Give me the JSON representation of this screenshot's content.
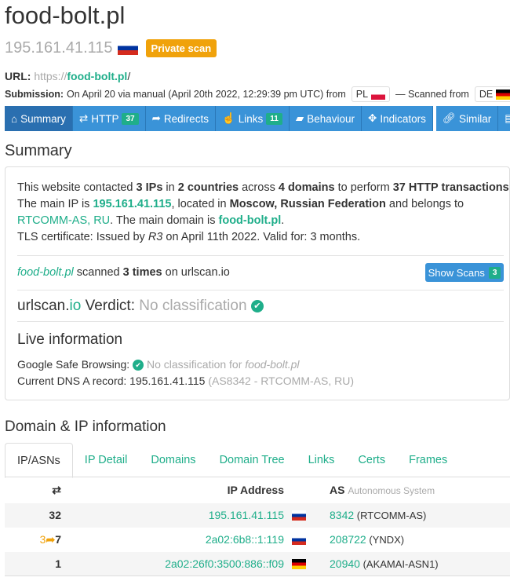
{
  "title": "food-bolt.pl",
  "ip": "195.161.41.115",
  "private_badge": "Private scan",
  "url": {
    "label": "URL:",
    "prefix": "https://",
    "domain": "food-bolt.pl",
    "suffix": "/"
  },
  "submission": {
    "label": "Submission:",
    "text": "On April 20 via manual (April 20th 2022, 12:29:39 pm UTC) from",
    "from_cc": "PL",
    "scanned_from": "— Scanned from",
    "scan_cc": "DE"
  },
  "tabs": [
    {
      "label": "Summary",
      "icon": "home-icon"
    },
    {
      "label": "HTTP",
      "count": "37",
      "icon": "exchange-icon"
    },
    {
      "label": "Redirects",
      "icon": "share-icon"
    },
    {
      "label": "Links",
      "count": "11",
      "icon": "thumbs-up-icon"
    },
    {
      "label": "Behaviour",
      "icon": "comment-icon"
    },
    {
      "label": "Indicators",
      "icon": "crosshair-icon"
    },
    {
      "label": "Similar",
      "icon": "link-icon"
    }
  ],
  "summary": {
    "heading": "Summary",
    "l1": [
      "This website contacted ",
      "3 IPs",
      " in ",
      "2 countries",
      " across ",
      "4 domains",
      " to perform ",
      "37 HTTP transactions",
      "."
    ],
    "l2": [
      "The main IP is ",
      "195.161.41.115",
      ", located in ",
      "Moscow, Russian Federation",
      " and belongs to"
    ],
    "l3": [
      "RTCOMM-AS, RU",
      ". The main domain is ",
      "food-bolt.pl",
      "."
    ],
    "l4": [
      "TLS certificate: Issued by ",
      "R3",
      " on April 11th 2022. Valid for: 3 months."
    ],
    "scanned": [
      "food-bolt.pl",
      " scanned ",
      "3 times",
      " on urlscan.io"
    ],
    "show_scans": "Show Scans",
    "show_scans_count": "3",
    "verdict": [
      "urlscan.",
      "io",
      " Verdict: ",
      "No classification"
    ],
    "live_heading": "Live information",
    "gsb_label": "Google Safe Browsing: ",
    "gsb_value": "No classification for ",
    "gsb_domain": "food-bolt.pl",
    "dns_label": "Current DNS A record: ",
    "dns_ip": "195.161.41.115",
    "dns_as": "(AS8342 - RTCOMM-AS, RU)"
  },
  "domain_ip": {
    "heading": "Domain & IP information",
    "tabs": [
      "IP/ASNs",
      "IP Detail",
      "Domains",
      "Domain Tree",
      "Links",
      "Certs",
      "Frames"
    ],
    "headers": {
      "ip": "IP Address",
      "as": "AS",
      "as_sub": "Autonomous System"
    },
    "rows": [
      {
        "redirects": "",
        "count": "32",
        "ip": "195.161.41.115",
        "flag": "ru",
        "asn": "8342",
        "as_name": "(RTCOMM-AS)"
      },
      {
        "redirects": "3",
        "count": "7",
        "ip": "2a02:6b8::1:119",
        "flag": "ru",
        "asn": "208722",
        "as_name": "(YNDX)"
      },
      {
        "redirects": "",
        "count": "1",
        "ip": "2a02:26f0:3500:886::f09",
        "flag": "de",
        "asn": "20940",
        "as_name": "(AKAMAI-ASN1)"
      }
    ]
  }
}
